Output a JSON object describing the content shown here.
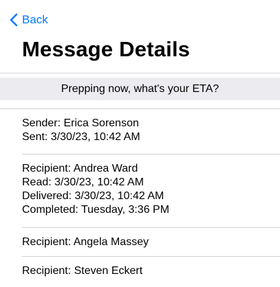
{
  "nav": {
    "back_label": "Back"
  },
  "header": {
    "title": "Message Details"
  },
  "message": {
    "text": "Prepping now, what's your ETA?"
  },
  "sender": {
    "line1": "Sender: Erica Sorenson",
    "line2": "Sent: 3/30/23, 10:42 AM"
  },
  "recipients": [
    {
      "name": "Recipient: Andrea Ward",
      "read": "Read: 3/30/23, 10:42 AM",
      "delivered": "Delivered: 3/30/23, 10:42 AM",
      "completed": "Completed: Tuesday, 3:36 PM"
    },
    {
      "name": "Recipient: Angela Massey"
    },
    {
      "name": "Recipient: Steven Eckert"
    }
  ],
  "colors": {
    "accent": "#007aff",
    "separator": "#d1d1d6",
    "message_bar_bg": "#ececf0"
  },
  "icons": {
    "back": "chevron-left-icon"
  }
}
